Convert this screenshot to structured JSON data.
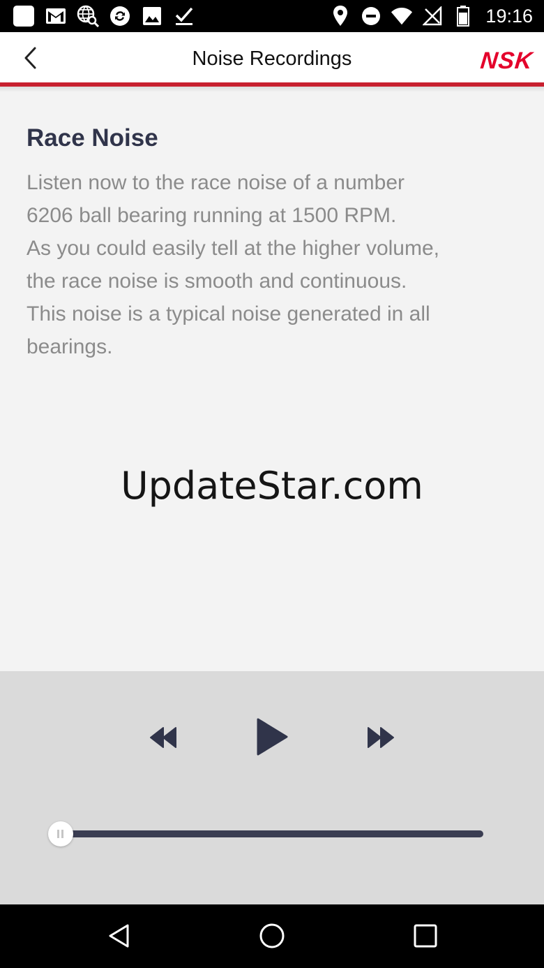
{
  "status_bar": {
    "time": "19:16",
    "left_icons": [
      "app-square-icon",
      "gmail-icon",
      "web-search-icon",
      "sync-icon",
      "image-icon",
      "checkmark-icon"
    ],
    "right_icons": [
      "location-icon",
      "do-not-disturb-icon",
      "wifi-icon",
      "no-signal-icon",
      "battery-icon"
    ]
  },
  "app_bar": {
    "title": "Noise Recordings",
    "brand": "NSK",
    "back_icon": "chevron-left-icon"
  },
  "content": {
    "heading": "Race Noise",
    "paragraph_lines": [
      "Listen now to the race noise of a number",
      "6206 ball bearing running at 1500 RPM.",
      "As you could easily tell at the higher volume,",
      "the race noise is smooth and continuous.",
      "This noise is a typical noise generated in all",
      "bearings."
    ],
    "watermark": "UpdateStar.com"
  },
  "player": {
    "controls": [
      "rewind-icon",
      "play-icon",
      "fast-forward-icon"
    ],
    "progress_fraction": 0.0
  },
  "nav_bar": {
    "buttons": [
      "back-triangle-icon",
      "home-circle-icon",
      "recents-square-icon"
    ]
  },
  "colors": {
    "accent": "#c8202f",
    "brand_red": "#e4002b",
    "heading": "#30344a",
    "body_text": "#8b8b8b",
    "player_bg": "#dadada",
    "track": "#3a3d52"
  }
}
